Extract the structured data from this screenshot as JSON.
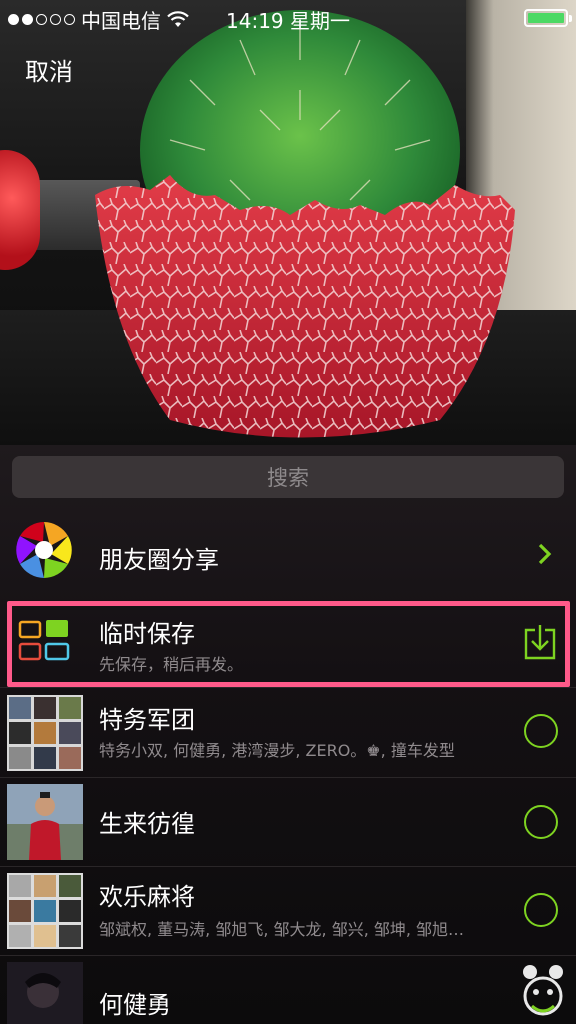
{
  "status_bar": {
    "carrier": "中国电信",
    "time_day": "14:19 星期一",
    "signal_bars_on": 2,
    "signal_bars_total": 5,
    "battery_level": 1.0,
    "battery_color": "#4cd964"
  },
  "header": {
    "cancel_label": "取消"
  },
  "search": {
    "placeholder": "搜索"
  },
  "rows": [
    {
      "title": "朋友圈分享",
      "subtitle": "",
      "icon": "aperture-icon",
      "action": "chevron-right-icon"
    },
    {
      "title": "临时保存",
      "subtitle": "先保存，稍后再发。",
      "icon": "grid-icon",
      "action": "download-icon",
      "highlighted": true
    },
    {
      "title": "特务军团",
      "subtitle": "特务小双, 何健勇, 港湾漫步, ZERO。♚, 撞车发型",
      "icon": "group-avatar",
      "action": "select-circle"
    },
    {
      "title": "生来彷徨",
      "subtitle": "",
      "icon": "person-avatar",
      "action": "select-circle"
    },
    {
      "title": "欢乐麻将",
      "subtitle": "邹斌权, 董马涛, 邹旭飞, 邹大龙, 邹兴, 邹坤, 邹旭…",
      "icon": "group-avatar",
      "action": "select-circle"
    },
    {
      "title": "何健勇",
      "subtitle": "",
      "icon": "person-avatar",
      "action": "select-circle"
    }
  ],
  "colors": {
    "accent_green": "#7ed321",
    "highlight_pink": "#ff5a8a"
  }
}
